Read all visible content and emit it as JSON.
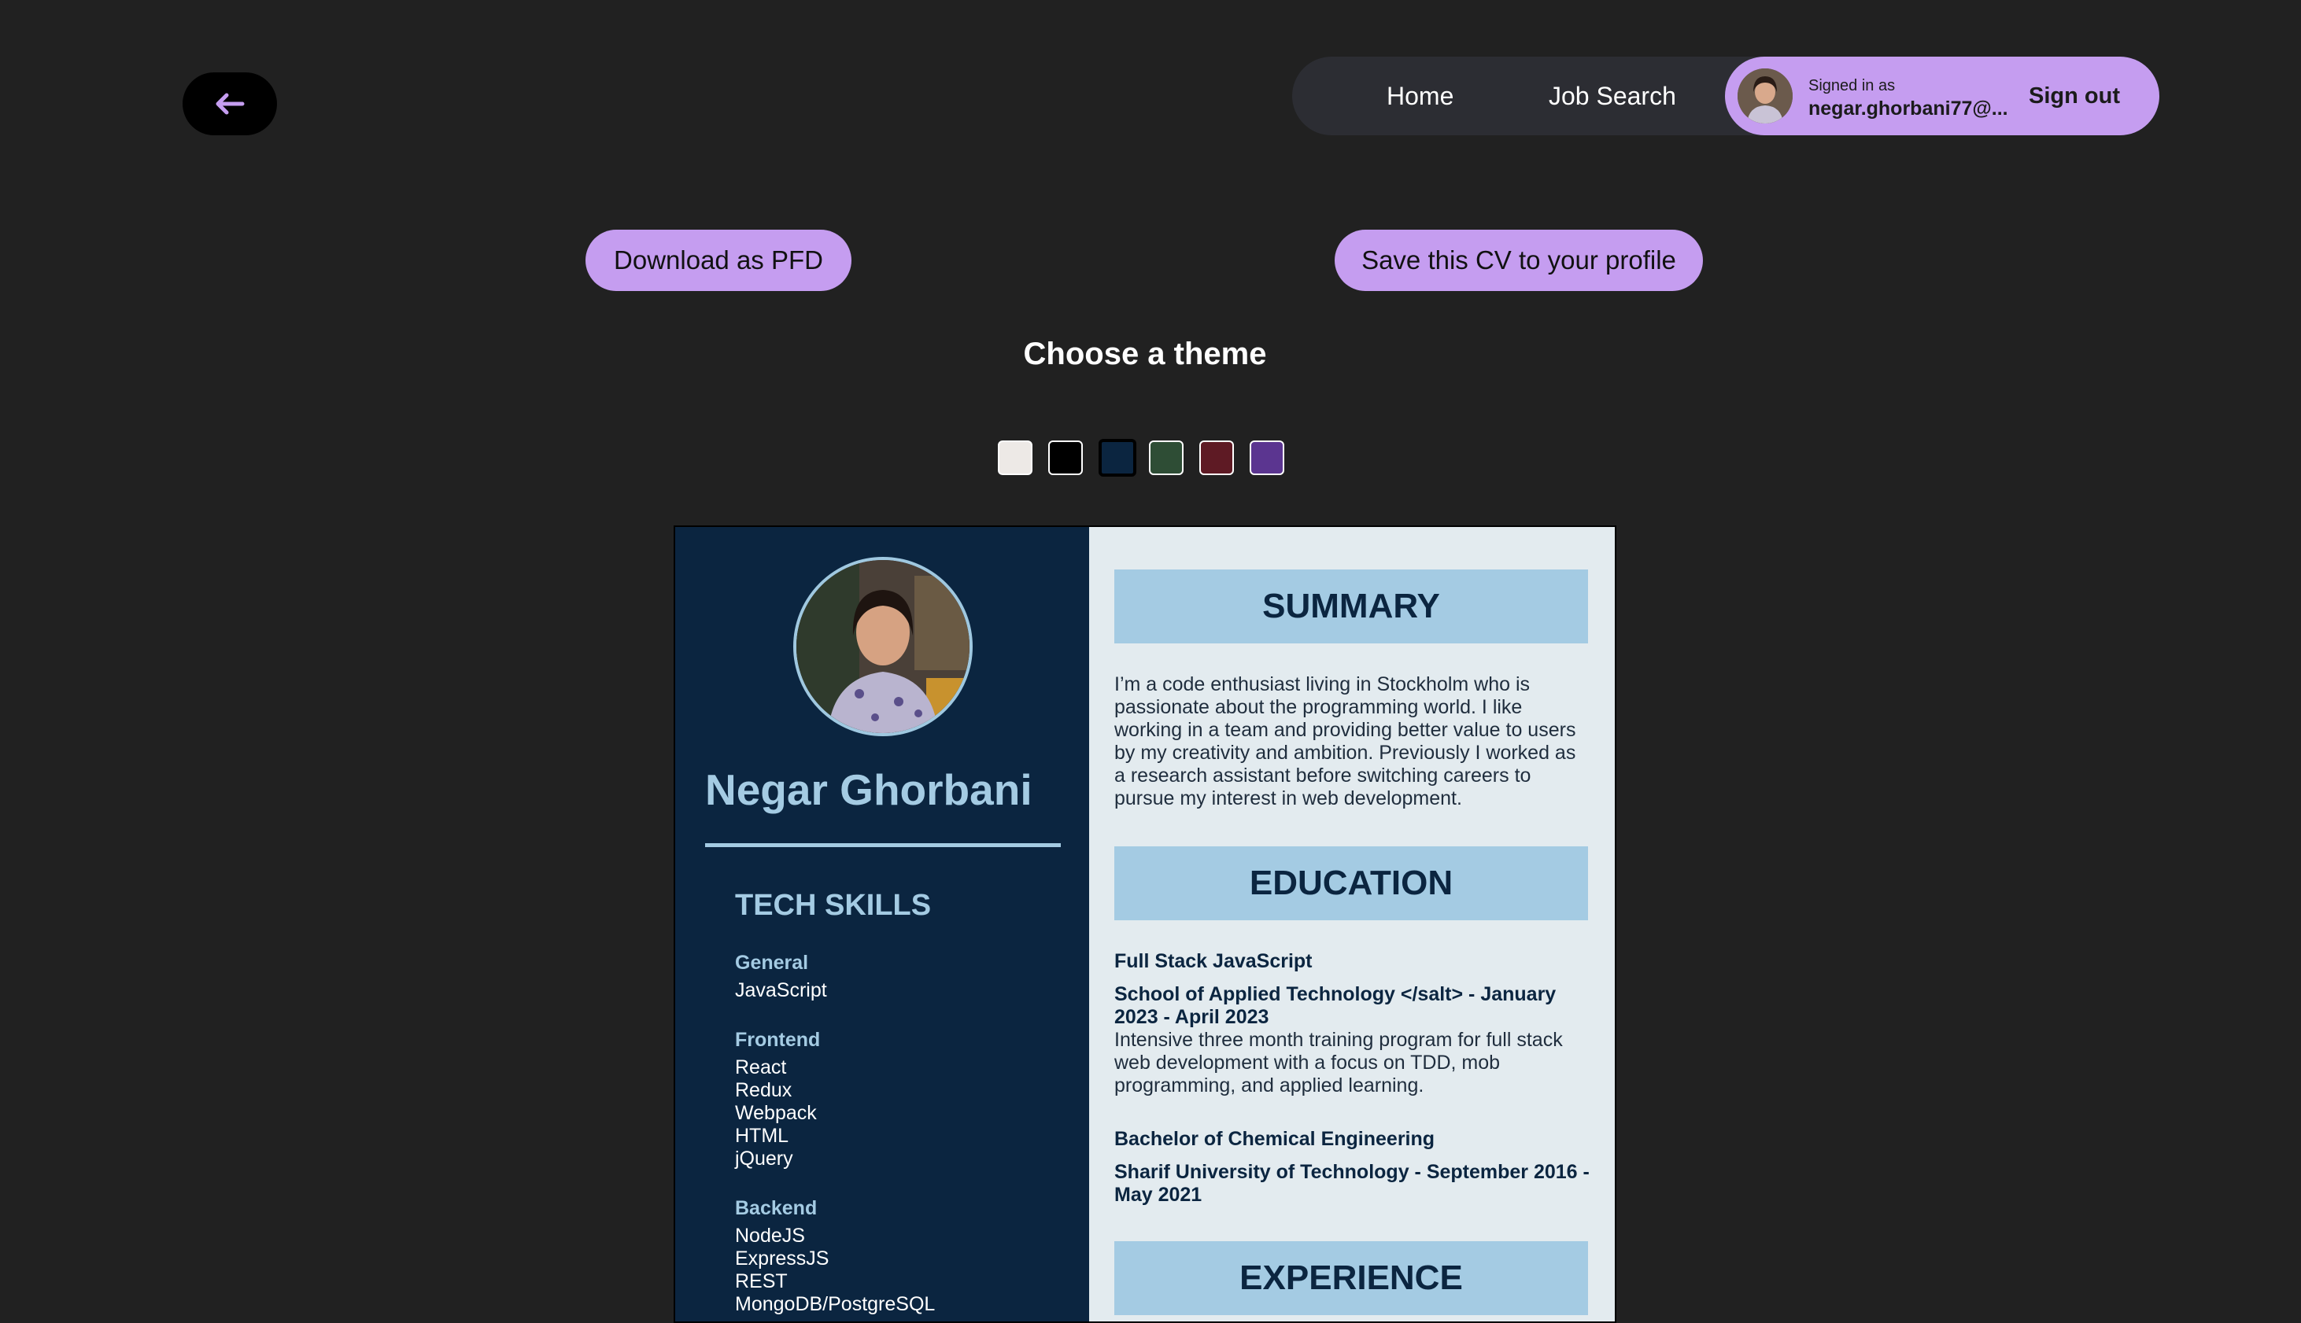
{
  "header": {
    "nav": {
      "home": "Home",
      "job_search": "Job Search"
    },
    "user": {
      "signed_in_label": "Signed in as",
      "email": "negar.ghorbani77@...",
      "sign_out": "Sign out"
    }
  },
  "actions": {
    "download": "Download as PFD",
    "save": "Save this CV to your profile"
  },
  "theme": {
    "title": "Choose a theme",
    "swatches": [
      "#ede9e6",
      "#000000",
      "#0b2540",
      "#2e4d35",
      "#5e1a24",
      "#5b3590"
    ],
    "selected_index": 2
  },
  "cv": {
    "name": "Negar Ghorbani",
    "skills_title": "TECH SKILLS",
    "skills": [
      {
        "heading": "General",
        "items": [
          "JavaScript"
        ]
      },
      {
        "heading": "Frontend",
        "items": [
          "React",
          "Redux",
          "Webpack",
          "HTML",
          "jQuery"
        ]
      },
      {
        "heading": "Backend",
        "items": [
          "NodeJS",
          "ExpressJS",
          "REST",
          "MongoDB/PostgreSQL"
        ]
      }
    ],
    "summary": {
      "title": "SUMMARY",
      "text": "I’m a code enthusiast living in Stockholm who is passionate about the programming world. I like working in a team and providing better value to users by my creativity and ambition. Previously I worked as a research assistant before switching careers to pursue my interest in web development."
    },
    "education": {
      "title": "EDUCATION",
      "entries": [
        {
          "degree": "Full Stack JavaScript",
          "school": "School of Applied Technology </salt> - January 2023 - April 2023",
          "description": "Intensive three month training program for full stack web development with a focus on TDD, mob programming, and applied learning."
        },
        {
          "degree": "Bachelor of Chemical Engineering",
          "school": "Sharif University of Technology - September 2016 - May 2021",
          "description": ""
        }
      ]
    },
    "experience": {
      "title": "EXPERIENCE"
    }
  }
}
